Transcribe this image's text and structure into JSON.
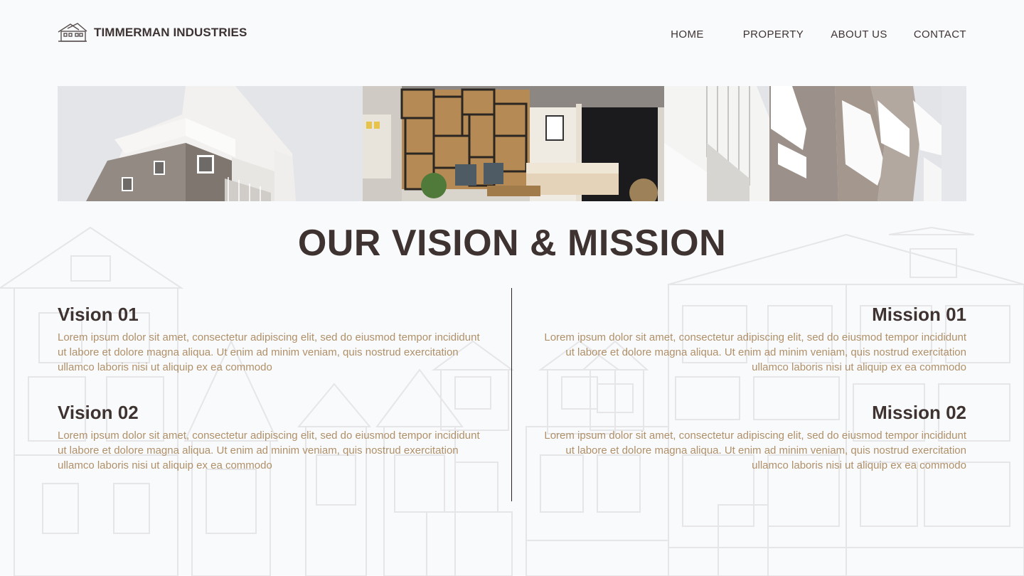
{
  "brand": {
    "name": "TIMMERMAN INDUSTRIES",
    "icon": "house-icon"
  },
  "nav": {
    "home": "HOME",
    "property": "PROPERTY",
    "about": "ABOUT US",
    "contact": "CONTACT"
  },
  "hero": {
    "images": [
      "apartment-building-photo",
      "living-room-interior-photo",
      "balcony-facade-photo"
    ]
  },
  "title": "OUR VISION & MISSION",
  "vision": [
    {
      "heading": "Vision 01",
      "text": "Lorem ipsum dolor sit amet, consectetur adipiscing elit, sed do eiusmod tempor incididunt ut labore et dolore magna aliqua. Ut enim ad minim veniam, quis nostrud exercitation ullamco laboris nisi ut aliquip ex ea commodo"
    },
    {
      "heading": "Vision 02",
      "text": "Lorem ipsum dolor sit amet, consectetur adipiscing elit, sed do eiusmod tempor incididunt ut labore et dolore magna aliqua. Ut enim ad minim veniam, quis nostrud exercitation ullamco laboris nisi ut aliquip ex ea commodo"
    }
  ],
  "mission": [
    {
      "heading": "Mission 01",
      "text": "Lorem ipsum dolor sit amet, consectetur adipiscing elit, sed do eiusmod tempor incididunt ut labore et dolore magna aliqua. Ut enim ad minim veniam, quis nostrud exercitation ullamco laboris nisi ut aliquip ex ea commodo"
    },
    {
      "heading": "Mission 02",
      "text": "Lorem ipsum dolor sit amet, consectetur adipiscing elit, sed do eiusmod tempor incididunt ut labore et dolore magna aliqua. Ut enim ad minim veniam, quis nostrud exercitation ullamco laboris nisi ut aliquip ex ea commodo"
    }
  ],
  "colors": {
    "heading": "#3e3331",
    "body_text": "#b09069",
    "background": "#f9fafb",
    "divider": "#2a2323"
  }
}
